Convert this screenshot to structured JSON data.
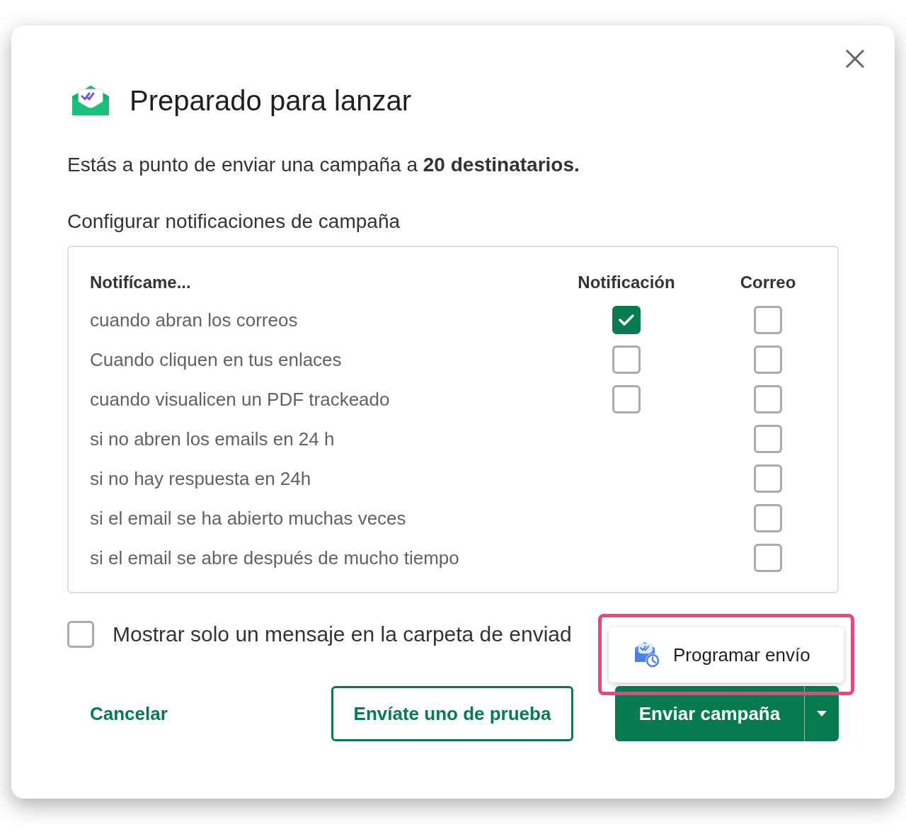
{
  "dialog": {
    "title": "Preparado para lanzar"
  },
  "summary": "Estás a punto de enviar una campaña a **20 destinatarios.**",
  "notifications": {
    "heading": "Configurar notificaciones de campaña",
    "columns": [
      "Notifícame...",
      "Notificación",
      "Correo"
    ],
    "rows": [
      {
        "label": "cuando abran los correos",
        "notification": {
          "checked": true
        },
        "email": {
          "checked": false
        }
      },
      {
        "label": "Cuando cliquen en tus enlaces",
        "notification": {
          "checked": false
        },
        "email": {
          "checked": false
        }
      },
      {
        "label": "cuando visualicen un PDF trackeado",
        "notification": {
          "checked": false
        },
        "email": {
          "checked": false
        }
      },
      {
        "label": "si no abren los emails en 24 h",
        "email": {
          "checked": false
        }
      },
      {
        "label": "si no hay respuesta en 24h",
        "email": {
          "checked": false
        }
      },
      {
        "label": "si el email se ha abierto muchas veces",
        "email": {
          "checked": false
        }
      },
      {
        "label": "si el email se abre después de mucho tiempo",
        "email": {
          "checked": false
        }
      }
    ]
  },
  "single_message_option": {
    "label": "Mostrar solo un mensaje en la carpeta de enviad",
    "checked": false
  },
  "actions": {
    "cancel": "Cancelar",
    "test": "Envíate uno de prueba",
    "send": "Enviar campaña"
  },
  "dropdown_menu": {
    "highlighted": true,
    "items": [
      {
        "label": "Programar envío"
      }
    ]
  }
}
